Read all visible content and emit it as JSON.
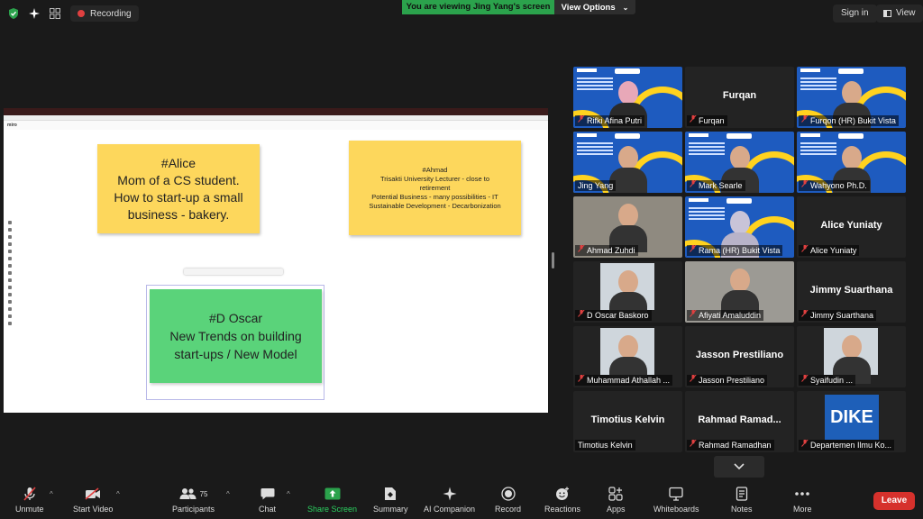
{
  "topbar": {
    "recording_label": "Recording",
    "viewing_banner": "You are viewing Jing Yang's screen",
    "view_options_label": "View Options",
    "sign_in_label": "Sign in",
    "view_label": "View"
  },
  "share": {
    "sticky_alice": {
      "line1": "#Alice",
      "line2": "Mom of a CS student.",
      "line3": "How to start-up a small",
      "line4": "business - bakery."
    },
    "sticky_ahmad": {
      "line1": "#Ahmad",
      "line2": "Trisakti University Lecturer - close to",
      "line3": "retirement",
      "line4": "Potential Business - many possibilities - IT",
      "line5": "Sustainable Development - Decarbonization"
    },
    "sticky_oscar": {
      "line1": "#D Oscar",
      "line2": "New Trends on building",
      "line3": "start-ups / New Model"
    },
    "miro_logo": "miro"
  },
  "gallery": {
    "tiles": [
      {
        "name": "Rifki Afina Putri"
      },
      {
        "name": "Furqan",
        "big": "Furqan"
      },
      {
        "name": "Furqon (HR) Bukit Vista"
      },
      {
        "name": "Jing Yang"
      },
      {
        "name": "Mark Searle"
      },
      {
        "name": "Wahyono Ph.D."
      },
      {
        "name": "Ahmad Zuhdi"
      },
      {
        "name": "Rama (HR) Bukit Vista"
      },
      {
        "name": "Alice Yuniaty",
        "big": "Alice Yuniaty"
      },
      {
        "name": "D Oscar Baskoro"
      },
      {
        "name": "Afiyati Amaluddin"
      },
      {
        "name": "Jimmy Suarthana",
        "big": "Jimmy Suarthana"
      },
      {
        "name": "Muhammad Athallah ..."
      },
      {
        "name": "Jasson Prestiliano",
        "big": "Jasson Prestiliano"
      },
      {
        "name": "Syaifudin ..."
      },
      {
        "name": "Timotius Kelvin",
        "big": "Timotius Kelvin"
      },
      {
        "name": "Rahmad Ramadhan",
        "big": "Rahmad  Ramad..."
      },
      {
        "name": "Departemen Ilmu Ko...",
        "logo": "DIKE"
      }
    ]
  },
  "toolbar": {
    "unmute": "Unmute",
    "start_video": "Start Video",
    "participants": "Participants",
    "participants_count": "75",
    "chat": "Chat",
    "share_screen": "Share Screen",
    "summary": "Summary",
    "ai_companion": "AI Companion",
    "record": "Record",
    "reactions": "Reactions",
    "apps": "Apps",
    "whiteboards": "Whiteboards",
    "notes": "Notes",
    "more": "More",
    "leave": "Leave"
  },
  "colors": {
    "accent_green": "#2ba24c",
    "leave_red": "#d6312c",
    "sticky_yellow": "#fdd75c",
    "sticky_green": "#5ad37a",
    "active_speaker": "#e5e56a"
  }
}
